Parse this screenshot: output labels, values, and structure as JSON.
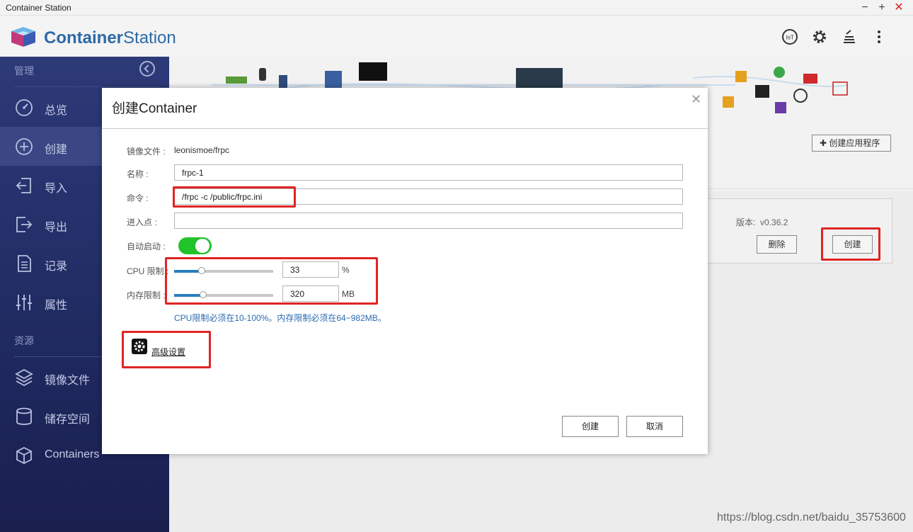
{
  "window": {
    "title": "Container Station",
    "min": "−",
    "max": "+",
    "close": "✕"
  },
  "header": {
    "brand_bold": "Container",
    "brand_light": "Station",
    "icons": [
      "iot-icon",
      "gear-icon",
      "stack-icon",
      "more-vertical-icon"
    ]
  },
  "sidebar": {
    "section_manage": "管理",
    "items": [
      {
        "label": "总览",
        "icon": "dashboard-icon",
        "active": false
      },
      {
        "label": "创建",
        "icon": "plus-circle-icon",
        "active": true
      },
      {
        "label": "导入",
        "icon": "import-icon",
        "active": false
      },
      {
        "label": "导出",
        "icon": "export-icon",
        "active": false
      },
      {
        "label": "记录",
        "icon": "document-icon",
        "active": false
      },
      {
        "label": "属性",
        "icon": "sliders-icon",
        "active": false
      }
    ],
    "section_resources": "资源",
    "resources": [
      {
        "label": "镜像文件",
        "icon": "layers-icon"
      },
      {
        "label": "储存空间",
        "icon": "database-icon"
      },
      {
        "label": "Containers",
        "icon": "cube-icon"
      }
    ]
  },
  "main": {
    "create_app_label": "创建应用程序",
    "version_label": "版本:",
    "version_value": "v0.36.2",
    "delete_label": "删除",
    "create_label": "创建"
  },
  "dialog": {
    "title": "创建Container",
    "close": "✕",
    "image_label": "镜像文件 :",
    "image_value": "leonismoe/frpc",
    "name_label": "名称 :",
    "name_value": "frpc-1",
    "command_label": "命令 :",
    "command_value": "/frpc -c /public/frpc.ini",
    "entrypoint_label": "进入点 :",
    "entrypoint_value": "",
    "autostart_label": "自动启动 :",
    "autostart_on": true,
    "cpu_label": "CPU 限制 :",
    "cpu_value": "33",
    "cpu_unit": "%",
    "cpu_fraction": 0.28,
    "mem_label": "内存限制 :",
    "mem_value": "320",
    "mem_unit": "MB",
    "mem_fraction": 0.29,
    "hint": "CPU限制必须在10-100%。内存限制必须在64−982MB。",
    "advanced_label": "高级设置",
    "create_button": "创建",
    "cancel_button": "取消"
  },
  "watermark": "https://blog.csdn.net/baidu_35753600",
  "colors": {
    "sidebar_bg": "#2d3a78",
    "brand": "#2c6aa6",
    "toggle_on": "#22c22a",
    "highlight_red": "#e02424",
    "slider_fill": "#2a7ec0"
  }
}
